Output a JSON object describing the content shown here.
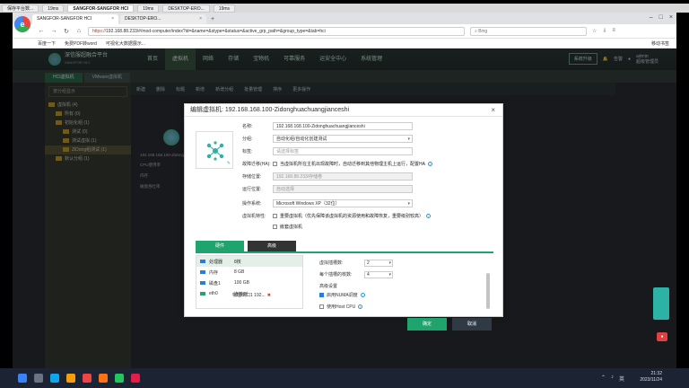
{
  "outer_tabs": [
    "保存平台数...",
    "19ms",
    "SANGFOR-SANGFOR HCI",
    "19ms",
    "DESKTOP-ERO...",
    "19ms",
    "19ms"
  ],
  "browser": {
    "tabs": [
      {
        "label": "SANGFOR-SANGFOR HCI"
      },
      {
        "label": "DESKTOP-ERO..."
      }
    ],
    "url_prefix": "https://",
    "url": "192.168.88.233/#/mod-computer/index?id=&name=&stype=&status=&active_grp_path=&group_type=&tab=hci",
    "search_placeholder": "Bing",
    "bookmarks": [
      "百度一下",
      "免费PDF转word",
      "可视化大数据展示..."
    ],
    "bookmarks_right": "移动书签"
  },
  "app": {
    "title": "深信服超融合平台",
    "subtitle": "SANGFOR HCI",
    "nav": [
      "首页",
      "虚拟机",
      "网络",
      "存储",
      "宝物机",
      "可靠服务",
      "运安全中心",
      "系统管理"
    ],
    "active_nav": "虚拟机",
    "upgrade": "系统升级",
    "alarm": "告警",
    "user": "admin",
    "user_sub": "超级管理员",
    "sub_tabs": [
      "HCI虚拟机",
      "VMware虚拟机"
    ],
    "left_search": "按分组显示",
    "tree": [
      "虚拟机 (4)",
      "所有 (0)",
      "初始化组 (1)",
      "测试 (0)",
      "测试虚拟 (1)",
      "ZiDong组测试 (1)",
      "默认分组 (1)"
    ],
    "toolbar": [
      "新建",
      "删除",
      "标题",
      "新增",
      "新增分组",
      "批量管理",
      "排序",
      "更多操作"
    ],
    "vm_card": {
      "name": "192.168.168.100-Zidonghuach...",
      "cpu": "CPU使用率",
      "mem": "内存",
      "disk": "磁盘吞吐率"
    }
  },
  "dialog": {
    "title": "编辑虚拟机: 192.168.168.100-Zidonghuachuangjianceshi",
    "fields": {
      "name_label": "名称:",
      "name_value": "192.168.168.100-Zidonghuachuangjianceshi",
      "group_label": "分组:",
      "group_value": "自动化组/自动化创建测试",
      "tag_label": "标签:",
      "tag_placeholder": "请选择标签",
      "ha_label": "故障迁移(HA):",
      "ha_text": "当虚拟机所在主机出现故障时，自动迁移到其他物理主机上运行，配置HA",
      "storage_label": "存储位置:",
      "storage_value": "192.168.88.233/存储卷",
      "run_label": "运行位置:",
      "run_value": "自动选择",
      "os_label": "操作系统:",
      "os_value": "Microsoft Windows XP（32位）",
      "vm_attr_label": "虚拟机特性:",
      "vm_attr_important": "重要虚拟机（优先保障该虚拟机的资源使用和故障恢复，重要级别较高）",
      "vm_attr_nested": "嵌套虚拟机"
    },
    "hw_tabs": [
      "硬件",
      "高级"
    ],
    "hw_list": [
      {
        "name": "处理器",
        "value": "8核"
      },
      {
        "name": "内存",
        "value": "8 GB"
      },
      {
        "name": "磁盘1",
        "value": "100 GB"
      },
      {
        "name": "eth0",
        "value": "连接到:"
      }
    ],
    "eth_extra": "物理出口1  192...",
    "hw_right": {
      "sockets_label": "虚拟插槽数:",
      "sockets_value": "2",
      "cores_label": "每个插槽的核数:",
      "cores_value": "4",
      "advanced_title": "高级设置",
      "numa_label": "启用NUMA调度",
      "hostcpu_label": "使用Host CPU"
    },
    "ok": "确定",
    "cancel": "取消"
  },
  "taskbar": {
    "time": "21:32",
    "date": "2023/11/24",
    "tray": "英"
  },
  "colors": {
    "accent_green": "#1fa46e",
    "link_blue": "#2a7ed3",
    "app_bg": "#2a2f33"
  }
}
